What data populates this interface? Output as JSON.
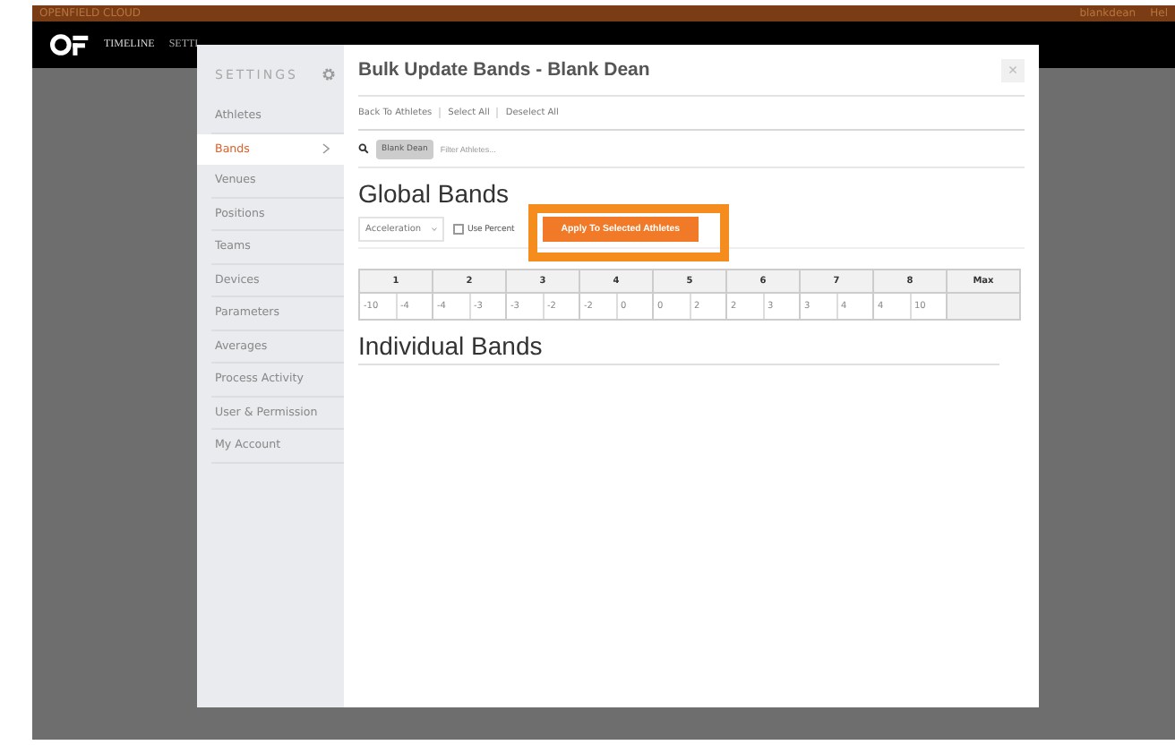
{
  "top_bar": {
    "brand": "OPENFIELD CLOUD",
    "user": "blankdean",
    "help": "Hel"
  },
  "nav": {
    "items": [
      "TIMELINE",
      "SETTI"
    ]
  },
  "modal": {
    "title": "Bulk Update Bands - Blank Dean",
    "close": "×",
    "sidebar": {
      "heading": "SETTINGS",
      "items": [
        {
          "label": "Athletes",
          "selected": false
        },
        {
          "label": "Bands",
          "selected": true
        },
        {
          "label": "Venues",
          "selected": false
        },
        {
          "label": "Positions",
          "selected": false
        },
        {
          "label": "Teams",
          "selected": false
        },
        {
          "label": "Devices",
          "selected": false
        },
        {
          "label": "Parameters",
          "selected": false
        },
        {
          "label": "Averages",
          "selected": false
        },
        {
          "label": "Process Activity",
          "selected": false
        },
        {
          "label": "User & Permission",
          "selected": false
        },
        {
          "label": "My Account",
          "selected": false
        }
      ]
    },
    "links": [
      "Back To Athletes",
      "Select All",
      "Deselect All"
    ],
    "filter": {
      "chip": "Blank Dean",
      "placeholder": "Filter Athletes..."
    },
    "global_heading": "Global Bands",
    "select": {
      "value": "Acceleration"
    },
    "checkbox": {
      "label": "Use Percent",
      "checked": false
    },
    "apply_button": "Apply To Selected Athletes",
    "bands": [
      {
        "label": "1",
        "low": "-10",
        "high": "-4"
      },
      {
        "label": "2",
        "low": "-4",
        "high": "-3"
      },
      {
        "label": "3",
        "low": "-3",
        "high": "-2"
      },
      {
        "label": "4",
        "low": "-2",
        "high": "0"
      },
      {
        "label": "5",
        "low": "0",
        "high": "2"
      },
      {
        "label": "6",
        "low": "2",
        "high": "3"
      },
      {
        "label": "7",
        "low": "3",
        "high": "4"
      },
      {
        "label": "8",
        "low": "4",
        "high": "10"
      },
      {
        "label": "Max"
      }
    ],
    "individual_heading": "Individual Bands"
  }
}
